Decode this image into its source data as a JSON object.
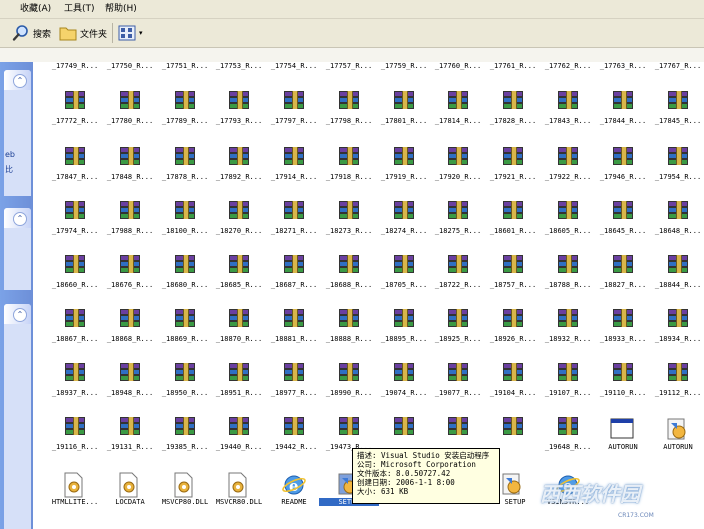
{
  "menu": {
    "favorites": "收藏(A)",
    "tools": "工具(T)",
    "help": "帮助(H)"
  },
  "toolbar": {
    "search": "搜索",
    "folders": "文件夹"
  },
  "sidebar": {
    "text_eb": "eb",
    "text_bi": "比"
  },
  "rows": [
    [
      "_17749_R...",
      "_17750_R...",
      "_17751_R...",
      "_17753_R...",
      "_17754_R...",
      "_17757_R...",
      "_17759_R...",
      "_17760_R...",
      "_17761_R...",
      "_17762_R...",
      "_17763_R...",
      "_17767_R..."
    ],
    [
      "_17772_R...",
      "_17780_R...",
      "_17789_R...",
      "_17793_R...",
      "_17797_R...",
      "_17798_R...",
      "_17801_R...",
      "_17814_R...",
      "_17828_R...",
      "_17843_R...",
      "_17844_R...",
      "_17845_R..."
    ],
    [
      "_17847_R...",
      "_17848_R...",
      "_17878_R...",
      "_17892_R...",
      "_17914_R...",
      "_17918_R...",
      "_17919_R...",
      "_17920_R...",
      "_17921_R...",
      "_17922_R...",
      "_17946_R...",
      "_17954_R..."
    ],
    [
      "_17974_R...",
      "_17988_R...",
      "_18100_R...",
      "_18270_R...",
      "_18271_R...",
      "_18273_R...",
      "_18274_R...",
      "_18275_R...",
      "_18601_R...",
      "_18605_R...",
      "_18645_R...",
      "_18648_R..."
    ],
    [
      "_18660_R...",
      "_18676_R...",
      "_18680_R...",
      "_18685_R...",
      "_18687_R...",
      "_18688_R...",
      "_18705_R...",
      "_18722_R...",
      "_18757_R...",
      "_18788_R...",
      "_18827_R...",
      "_18844_R..."
    ],
    [
      "_18867_R...",
      "_18868_R...",
      "_18869_R...",
      "_18870_R...",
      "_18881_R...",
      "_18888_R...",
      "_18895_R...",
      "_18925_R...",
      "_18926_R...",
      "_18932_R...",
      "_18933_R...",
      "_18934_R..."
    ],
    [
      "_18937_R...",
      "_18948_R...",
      "_18950_R...",
      "_18951_R...",
      "_18977_R...",
      "_18990_R...",
      "_19074_R...",
      "_19077_R...",
      "_19104_R...",
      "_19107_R...",
      "_19110_R...",
      "_19112_R..."
    ],
    [
      "_19116_R...",
      "_19131_R...",
      "_19385_R...",
      "_19440_R...",
      "_19442_R...",
      "_19473_R...",
      "",
      "",
      "",
      "_19648_R...",
      "AUTORUN",
      "AUTORUN"
    ],
    [
      "HTMLLITE...",
      "LOCDATA",
      "MSVCP80.DLL",
      "MSVCR80.DLL",
      "README",
      "SETUP",
      "",
      "",
      "",
      "VSINSTR...",
      "",
      ""
    ]
  ],
  "partial_names": {
    "r8_c6": "...",
    "r8_c8": "SETUP"
  },
  "tooltip": {
    "line1": "描述: Visual Studio 安装启动程序",
    "line2": "公司: Microsoft Corporation",
    "line3": "文件版本: 8.0.50727.42",
    "line4": "创建日期: 2006-1-1 8:00",
    "line5": "大小: 631 KB"
  },
  "watermark": {
    "text": "西西软件园",
    "sub": "CR173.COM"
  },
  "colors": {
    "sidebar": "#6d8fd8",
    "tooltip_bg": "#ffffe1",
    "toolbar_bg": "#ece9d8"
  }
}
